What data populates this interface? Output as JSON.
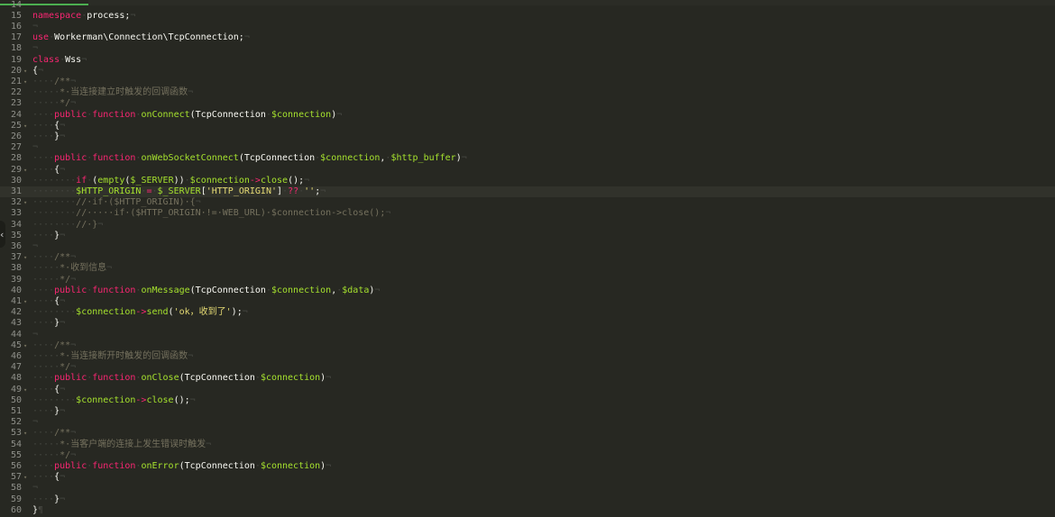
{
  "tabs": {
    "active_label": ""
  },
  "editor": {
    "active_line": 31,
    "lines": [
      {
        "n": "14",
        "fold": false,
        "segs": []
      },
      {
        "n": "15",
        "fold": false,
        "segs": [
          [
            "kw",
            "namespace"
          ],
          [
            "ws",
            "·"
          ],
          [
            "plain",
            "process;"
          ],
          [
            "ws",
            "¬"
          ]
        ]
      },
      {
        "n": "16",
        "fold": false,
        "segs": [
          [
            "ws",
            "¬"
          ]
        ]
      },
      {
        "n": "17",
        "fold": false,
        "segs": [
          [
            "kw",
            "use"
          ],
          [
            "ws",
            "·"
          ],
          [
            "plain",
            "Workerman\\Connection\\TcpConnection;"
          ],
          [
            "ws",
            "¬"
          ]
        ]
      },
      {
        "n": "18",
        "fold": false,
        "segs": [
          [
            "ws",
            "¬"
          ]
        ]
      },
      {
        "n": "19",
        "fold": false,
        "segs": [
          [
            "kw",
            "class"
          ],
          [
            "ws",
            "·"
          ],
          [
            "cls",
            "Wss"
          ],
          [
            "ws",
            "¬"
          ]
        ]
      },
      {
        "n": "20",
        "fold": true,
        "segs": [
          [
            "plain",
            "{"
          ],
          [
            "ws",
            "¬"
          ]
        ]
      },
      {
        "n": "21",
        "fold": true,
        "segs": [
          [
            "ws",
            "····"
          ],
          [
            "cm",
            "/**"
          ],
          [
            "ws",
            "¬"
          ]
        ]
      },
      {
        "n": "22",
        "fold": false,
        "segs": [
          [
            "ws",
            "·····"
          ],
          [
            "cm",
            "*·当连接建立时触发的回调函数"
          ],
          [
            "ws",
            "¬"
          ]
        ]
      },
      {
        "n": "23",
        "fold": false,
        "segs": [
          [
            "ws",
            "·····"
          ],
          [
            "cm",
            "*/"
          ],
          [
            "ws",
            "¬"
          ]
        ]
      },
      {
        "n": "24",
        "fold": false,
        "segs": [
          [
            "ws",
            "····"
          ],
          [
            "kw",
            "public"
          ],
          [
            "ws",
            "·"
          ],
          [
            "kw",
            "function"
          ],
          [
            "ws",
            "·"
          ],
          [
            "fn",
            "onConnect"
          ],
          [
            "plain",
            "(TcpConnection"
          ],
          [
            "ws",
            "·"
          ],
          [
            "var",
            "$connection"
          ],
          [
            "plain",
            ")"
          ],
          [
            "ws",
            "¬"
          ]
        ]
      },
      {
        "n": "25",
        "fold": true,
        "segs": [
          [
            "ws",
            "····"
          ],
          [
            "plain",
            "{"
          ],
          [
            "ws",
            "¬"
          ]
        ]
      },
      {
        "n": "26",
        "fold": false,
        "segs": [
          [
            "ws",
            "····"
          ],
          [
            "plain",
            "}"
          ],
          [
            "ws",
            "¬"
          ]
        ]
      },
      {
        "n": "27",
        "fold": false,
        "segs": [
          [
            "ws",
            "¬"
          ]
        ]
      },
      {
        "n": "28",
        "fold": false,
        "segs": [
          [
            "ws",
            "····"
          ],
          [
            "kw",
            "public"
          ],
          [
            "ws",
            "·"
          ],
          [
            "kw",
            "function"
          ],
          [
            "ws",
            "·"
          ],
          [
            "fn",
            "onWebSocketConnect"
          ],
          [
            "plain",
            "(TcpConnection"
          ],
          [
            "ws",
            "·"
          ],
          [
            "var",
            "$connection"
          ],
          [
            "plain",
            ","
          ],
          [
            "ws",
            "·"
          ],
          [
            "var",
            "$http_buffer"
          ],
          [
            "plain",
            ")"
          ],
          [
            "ws",
            "¬"
          ]
        ]
      },
      {
        "n": "29",
        "fold": true,
        "segs": [
          [
            "ws",
            "····"
          ],
          [
            "plain",
            "{"
          ],
          [
            "ws",
            "¬"
          ]
        ]
      },
      {
        "n": "30",
        "fold": false,
        "segs": [
          [
            "ws",
            "········"
          ],
          [
            "kw",
            "if"
          ],
          [
            "ws",
            "·"
          ],
          [
            "plain",
            "("
          ],
          [
            "fn",
            "empty"
          ],
          [
            "plain",
            "("
          ],
          [
            "var",
            "$_SERVER"
          ],
          [
            "plain",
            "))"
          ],
          [
            "ws",
            "·"
          ],
          [
            "var",
            "$connection"
          ],
          [
            "kw",
            "->"
          ],
          [
            "fn",
            "close"
          ],
          [
            "plain",
            "();"
          ],
          [
            "ws",
            "¬"
          ]
        ]
      },
      {
        "n": "31",
        "fold": false,
        "segs": [
          [
            "ws",
            "········"
          ],
          [
            "var",
            "$HTTP_ORIGIN"
          ],
          [
            "ws",
            "·"
          ],
          [
            "kw",
            "="
          ],
          [
            "ws",
            "·"
          ],
          [
            "var",
            "$_SERVER"
          ],
          [
            "plain",
            "["
          ],
          [
            "str",
            "'HTTP_ORIGIN'"
          ],
          [
            "plain",
            "]"
          ],
          [
            "ws",
            "·"
          ],
          [
            "kw",
            "??"
          ],
          [
            "ws",
            "·"
          ],
          [
            "str",
            "''"
          ],
          [
            "plain",
            ";"
          ],
          [
            "ws",
            "¬"
          ]
        ]
      },
      {
        "n": "32",
        "fold": true,
        "segs": [
          [
            "ws",
            "········"
          ],
          [
            "cm",
            "//·if·($HTTP_ORIGIN)·{"
          ],
          [
            "ws",
            "¬"
          ]
        ]
      },
      {
        "n": "33",
        "fold": false,
        "segs": [
          [
            "ws",
            "········"
          ],
          [
            "cm",
            "//·····if·($HTTP_ORIGIN·!=·WEB_URL)·$connection->close();"
          ],
          [
            "ws",
            "¬"
          ]
        ]
      },
      {
        "n": "34",
        "fold": false,
        "segs": [
          [
            "ws",
            "········"
          ],
          [
            "cm",
            "//·}"
          ],
          [
            "ws",
            "¬"
          ]
        ]
      },
      {
        "n": "35",
        "fold": false,
        "segs": [
          [
            "ws",
            "····"
          ],
          [
            "plain",
            "}"
          ],
          [
            "ws",
            "¬"
          ]
        ]
      },
      {
        "n": "36",
        "fold": false,
        "segs": [
          [
            "ws",
            "¬"
          ]
        ]
      },
      {
        "n": "37",
        "fold": true,
        "segs": [
          [
            "ws",
            "····"
          ],
          [
            "cm",
            "/**"
          ],
          [
            "ws",
            "¬"
          ]
        ]
      },
      {
        "n": "38",
        "fold": false,
        "segs": [
          [
            "ws",
            "·····"
          ],
          [
            "cm",
            "*·收到信息"
          ],
          [
            "ws",
            "¬"
          ]
        ]
      },
      {
        "n": "39",
        "fold": false,
        "segs": [
          [
            "ws",
            "·····"
          ],
          [
            "cm",
            "*/"
          ],
          [
            "ws",
            "¬"
          ]
        ]
      },
      {
        "n": "40",
        "fold": false,
        "segs": [
          [
            "ws",
            "····"
          ],
          [
            "kw",
            "public"
          ],
          [
            "ws",
            "·"
          ],
          [
            "kw",
            "function"
          ],
          [
            "ws",
            "·"
          ],
          [
            "fn",
            "onMessage"
          ],
          [
            "plain",
            "(TcpConnection"
          ],
          [
            "ws",
            "·"
          ],
          [
            "var",
            "$connection"
          ],
          [
            "plain",
            ","
          ],
          [
            "ws",
            "·"
          ],
          [
            "var",
            "$data"
          ],
          [
            "plain",
            ")"
          ],
          [
            "ws",
            "¬"
          ]
        ]
      },
      {
        "n": "41",
        "fold": true,
        "segs": [
          [
            "ws",
            "····"
          ],
          [
            "plain",
            "{"
          ],
          [
            "ws",
            "¬"
          ]
        ]
      },
      {
        "n": "42",
        "fold": false,
        "segs": [
          [
            "ws",
            "········"
          ],
          [
            "var",
            "$connection"
          ],
          [
            "kw",
            "->"
          ],
          [
            "fn",
            "send"
          ],
          [
            "plain",
            "("
          ],
          [
            "str",
            "'ok，收到了'"
          ],
          [
            "plain",
            ");"
          ],
          [
            "ws",
            "¬"
          ]
        ]
      },
      {
        "n": "43",
        "fold": false,
        "segs": [
          [
            "ws",
            "····"
          ],
          [
            "plain",
            "}"
          ],
          [
            "ws",
            "¬"
          ]
        ]
      },
      {
        "n": "44",
        "fold": false,
        "segs": [
          [
            "ws",
            "¬"
          ]
        ]
      },
      {
        "n": "45",
        "fold": true,
        "segs": [
          [
            "ws",
            "····"
          ],
          [
            "cm",
            "/**"
          ],
          [
            "ws",
            "¬"
          ]
        ]
      },
      {
        "n": "46",
        "fold": false,
        "segs": [
          [
            "ws",
            "·····"
          ],
          [
            "cm",
            "*·当连接断开时触发的回调函数"
          ],
          [
            "ws",
            "¬"
          ]
        ]
      },
      {
        "n": "47",
        "fold": false,
        "segs": [
          [
            "ws",
            "·····"
          ],
          [
            "cm",
            "*/"
          ],
          [
            "ws",
            "¬"
          ]
        ]
      },
      {
        "n": "48",
        "fold": false,
        "segs": [
          [
            "ws",
            "····"
          ],
          [
            "kw",
            "public"
          ],
          [
            "ws",
            "·"
          ],
          [
            "kw",
            "function"
          ],
          [
            "ws",
            "·"
          ],
          [
            "fn",
            "onClose"
          ],
          [
            "plain",
            "(TcpConnection"
          ],
          [
            "ws",
            "·"
          ],
          [
            "var",
            "$connection"
          ],
          [
            "plain",
            ")"
          ],
          [
            "ws",
            "¬"
          ]
        ]
      },
      {
        "n": "49",
        "fold": true,
        "segs": [
          [
            "ws",
            "····"
          ],
          [
            "plain",
            "{"
          ],
          [
            "ws",
            "¬"
          ]
        ]
      },
      {
        "n": "50",
        "fold": false,
        "segs": [
          [
            "ws",
            "········"
          ],
          [
            "var",
            "$connection"
          ],
          [
            "kw",
            "->"
          ],
          [
            "fn",
            "close"
          ],
          [
            "plain",
            "();"
          ],
          [
            "ws",
            "¬"
          ]
        ]
      },
      {
        "n": "51",
        "fold": false,
        "segs": [
          [
            "ws",
            "····"
          ],
          [
            "plain",
            "}"
          ],
          [
            "ws",
            "¬"
          ]
        ]
      },
      {
        "n": "52",
        "fold": false,
        "segs": [
          [
            "ws",
            "¬"
          ]
        ]
      },
      {
        "n": "53",
        "fold": true,
        "segs": [
          [
            "ws",
            "····"
          ],
          [
            "cm",
            "/**"
          ],
          [
            "ws",
            "¬"
          ]
        ]
      },
      {
        "n": "54",
        "fold": false,
        "segs": [
          [
            "ws",
            "·····"
          ],
          [
            "cm",
            "*·当客户端的连接上发生错误时触发"
          ],
          [
            "ws",
            "¬"
          ]
        ]
      },
      {
        "n": "55",
        "fold": false,
        "segs": [
          [
            "ws",
            "·····"
          ],
          [
            "cm",
            "*/"
          ],
          [
            "ws",
            "¬"
          ]
        ]
      },
      {
        "n": "56",
        "fold": false,
        "segs": [
          [
            "ws",
            "····"
          ],
          [
            "kw",
            "public"
          ],
          [
            "ws",
            "·"
          ],
          [
            "kw",
            "function"
          ],
          [
            "ws",
            "·"
          ],
          [
            "fn",
            "onError"
          ],
          [
            "plain",
            "(TcpConnection"
          ],
          [
            "ws",
            "·"
          ],
          [
            "var",
            "$connection"
          ],
          [
            "plain",
            ")"
          ],
          [
            "ws",
            "¬"
          ]
        ]
      },
      {
        "n": "57",
        "fold": true,
        "segs": [
          [
            "ws",
            "····"
          ],
          [
            "plain",
            "{"
          ],
          [
            "ws",
            "¬"
          ]
        ]
      },
      {
        "n": "58",
        "fold": false,
        "segs": [
          [
            "ws",
            "¬"
          ]
        ]
      },
      {
        "n": "59",
        "fold": false,
        "segs": [
          [
            "ws",
            "····"
          ],
          [
            "plain",
            "}"
          ],
          [
            "ws",
            "¬"
          ]
        ]
      },
      {
        "n": "60",
        "fold": false,
        "segs": [
          [
            "plain",
            "}"
          ],
          [
            "ws",
            "¶"
          ]
        ]
      }
    ]
  },
  "colors": {
    "background": "#272822",
    "keyword": "#f92672",
    "function": "#a6e22e",
    "string": "#e6db74",
    "comment": "#75715e",
    "text": "#f8f8f2",
    "tab_accent": "#4caf50"
  },
  "icons": {
    "fold_marker": "chevron-down-icon",
    "panel_toggle": "chevron-left-icon"
  }
}
